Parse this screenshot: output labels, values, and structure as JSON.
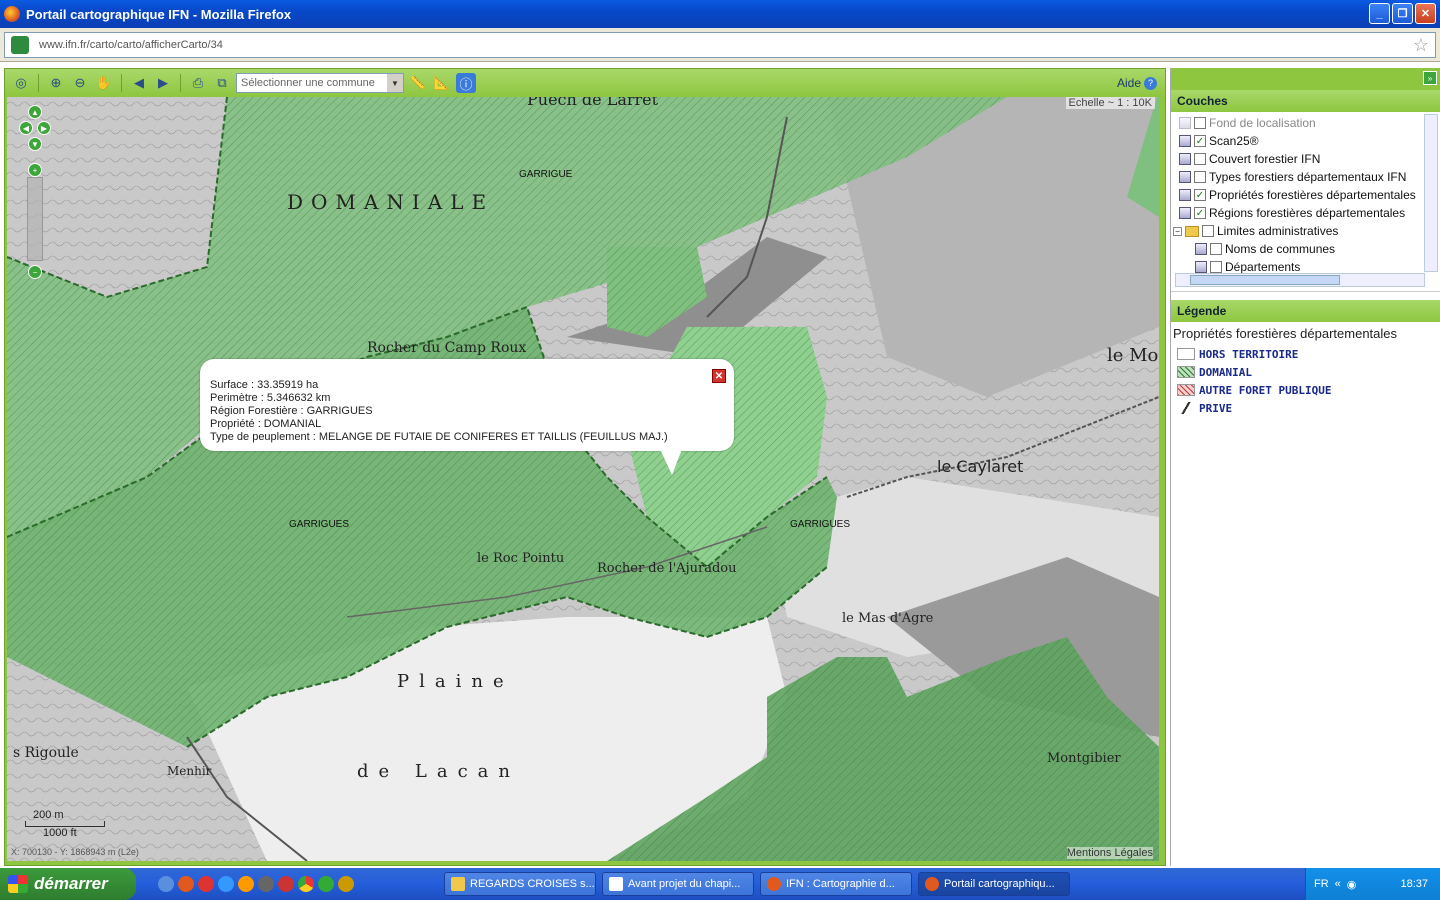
{
  "window": {
    "title": "Portail cartographique IFN - Mozilla Firefox",
    "url": "www.ifn.fr/carto/carto/afficherCarto/34"
  },
  "toolbar": {
    "commune_placeholder": "Sélectionner une commune",
    "aide_label": "Aide"
  },
  "map": {
    "scale": "Echelle ~ 1 : 10K",
    "scalebar_metric": "200 m",
    "scalebar_imperial": "1000 ft",
    "coords": "X: 700130 - Y: 1868943 m (L2e)",
    "mentions": "Mentions Légales",
    "labels": {
      "garrigue_top": "GARRIGUE",
      "garrigues_left": "GARRIGUES",
      "garrigues_right": "GARRIGUES"
    }
  },
  "popup": {
    "surface": "Surface : 33.35919 ha",
    "perimetre": "Perimètre : 5.346632 km",
    "region": "Région Forestière : GARRIGUES",
    "propriete": "Propriété : DOMANIAL",
    "peuplement": "Type de peuplement : MELANGE DE FUTAIE DE CONIFERES ET TAILLIS (FEUILLUS MAJ.)"
  },
  "couches": {
    "header": "Couches",
    "items": [
      {
        "label": "Fond de localisation",
        "checked": false,
        "dim": true
      },
      {
        "label": "Scan25®",
        "checked": true,
        "dim": false
      },
      {
        "label": "Couvert forestier IFN",
        "checked": false,
        "dim": false
      },
      {
        "label": "Types forestiers départementaux IFN",
        "checked": false,
        "dim": false
      },
      {
        "label": "Propriétés forestières départementales",
        "checked": true,
        "dim": false
      },
      {
        "label": "Régions forestières départementales",
        "checked": true,
        "dim": false
      },
      {
        "label": "Limites administratives",
        "checked": false,
        "dim": false
      },
      {
        "label": "Noms de communes",
        "checked": false,
        "dim": false
      },
      {
        "label": "Départements",
        "checked": false,
        "dim": false
      }
    ]
  },
  "legende": {
    "header": "Légende",
    "title": "Propriétés forestières départementales",
    "items": [
      "HORS TERRITOIRE",
      "DOMANIAL",
      "AUTRE FORET PUBLIQUE",
      "PRIVE"
    ]
  },
  "taskbar": {
    "start": "démarrer",
    "tasks": [
      "REGARDS CROISES s...",
      "Avant projet du chapi...",
      "IFN : Cartographie d...",
      "Portail cartographiqu..."
    ],
    "lang": "FR",
    "clock": "18:37"
  }
}
